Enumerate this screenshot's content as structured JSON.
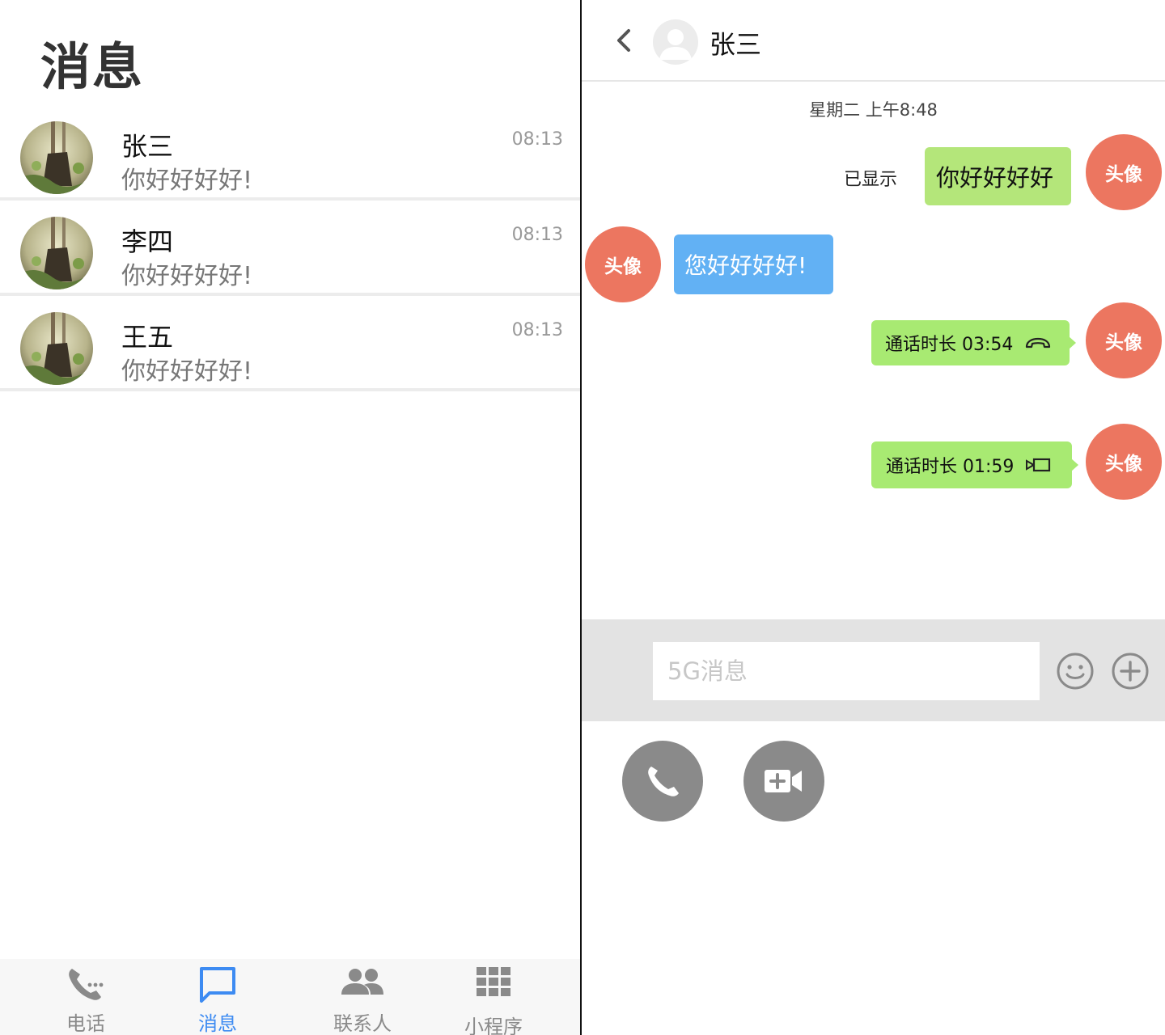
{
  "left_panel": {
    "title": "消息",
    "conversations": [
      {
        "name": "张三",
        "preview": "你好好好好!",
        "time": "08:13"
      },
      {
        "name": "李四",
        "preview": "你好好好好!",
        "time": "08:13"
      },
      {
        "name": "王五",
        "preview": "你好好好好!",
        "time": "08:13"
      }
    ],
    "tabs": [
      {
        "label": "电话",
        "icon": "phone-dial-icon",
        "active": false
      },
      {
        "label": "消息",
        "icon": "message-icon",
        "active": true
      },
      {
        "label": "联系人",
        "icon": "contacts-icon",
        "active": false
      },
      {
        "label": "小程序",
        "icon": "grid-apps-icon",
        "active": false
      }
    ]
  },
  "chat": {
    "contact_name": "张三",
    "timestamp": "星期二 上午8:48",
    "messages": [
      {
        "direction": "sent",
        "text": "你好好好好",
        "status": "已显示",
        "avatar_label": "头像"
      },
      {
        "direction": "received",
        "text": "您好好好好!",
        "avatar_label": "头像"
      },
      {
        "direction": "sent",
        "type": "call",
        "text": "通话时长 03:54",
        "icon": "hangup-icon",
        "avatar_label": "头像"
      },
      {
        "direction": "sent",
        "type": "call",
        "text": "通话时长 01:59",
        "icon": "video-call-icon",
        "avatar_label": "头像"
      }
    ],
    "input": {
      "placeholder": "5G消息",
      "value": ""
    },
    "actions": [
      {
        "icon": "phone-icon"
      },
      {
        "icon": "video-camera-icon"
      }
    ]
  },
  "colors": {
    "accent": "#3d8bf2",
    "avatar_badge": "#ec7660",
    "sent_bubble": "#b4e67a",
    "call_bubble": "#a8ea72",
    "received_bubble": "#62b1f4",
    "input_bar": "#e3e3e3",
    "action_button": "#8a8a8a"
  }
}
